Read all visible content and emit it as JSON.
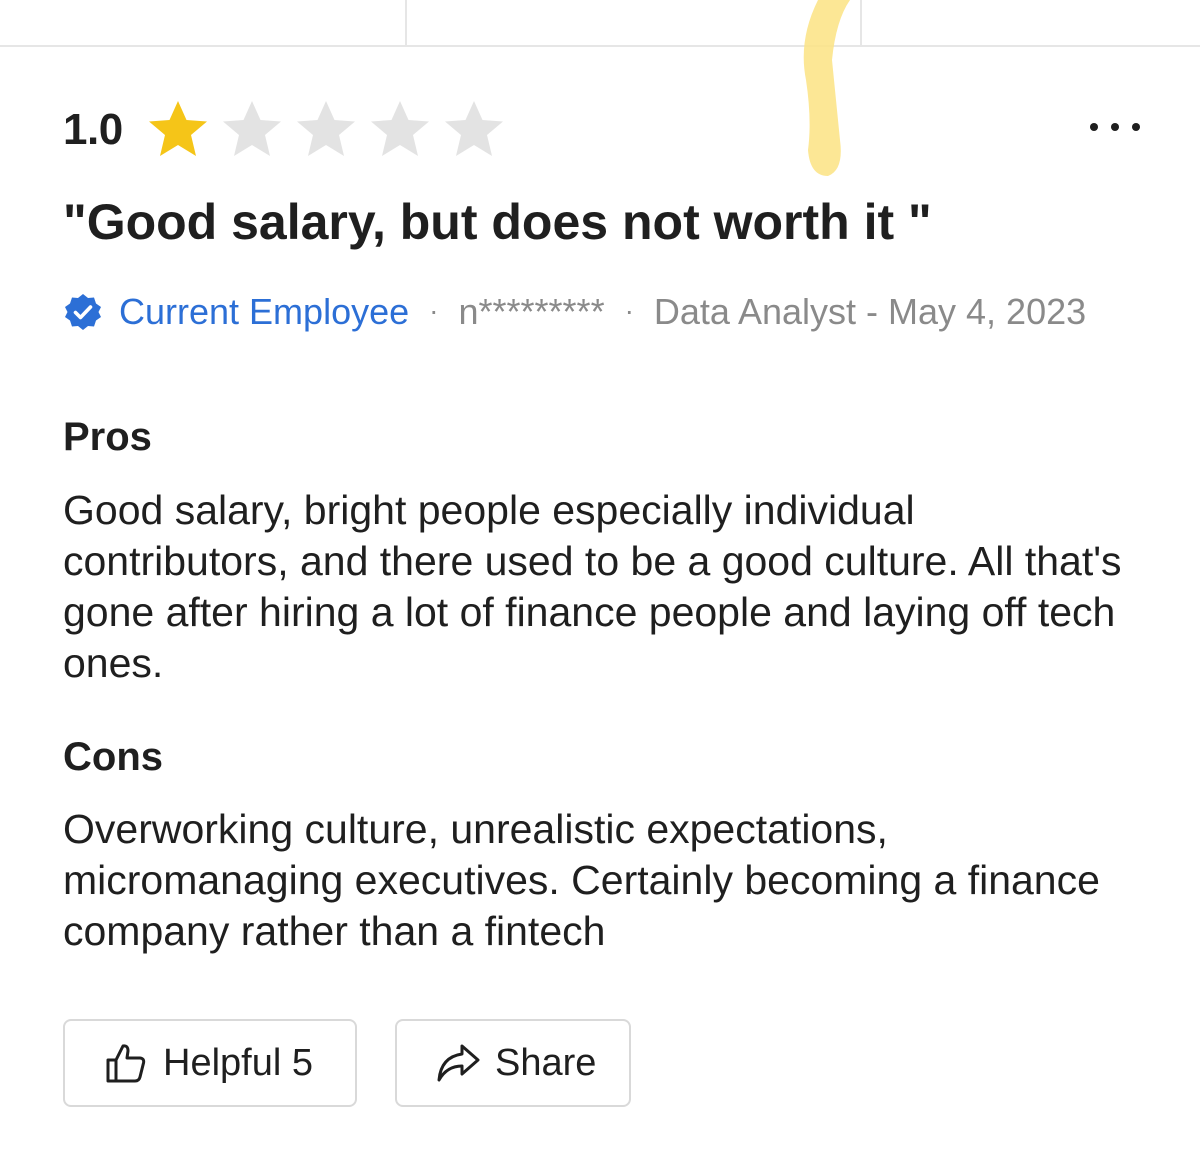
{
  "review": {
    "rating_value": "1.0",
    "rating": 1,
    "max_rating": 5,
    "title": "\"Good salary, but does not worth it \"",
    "employee_status": "Current Employee",
    "author": "n*********",
    "job_and_date": "Data Analyst - May 4, 2023",
    "separator": "·",
    "pros_heading": "Pros",
    "pros_text": "Good salary, bright people especially individual contributors, and there used to be a good culture. All that's gone after hiring a lot of finance people and laying off tech ones.",
    "cons_heading": "Cons",
    "cons_text": "Overworking culture, unrealistic expectations, micromanaging executives. Certainly becoming a finance company rather than a fintech"
  },
  "actions": {
    "helpful_label": "Helpful 5",
    "share_label": "Share"
  },
  "icons": {
    "star_filled": "star-filled-icon",
    "star_empty": "star-empty-icon",
    "verified": "verified-badge-icon",
    "more": "more-horizontal-icon",
    "thumbs_up": "thumbs-up-icon",
    "share": "share-arrow-icon"
  },
  "colors": {
    "star_filled": "#f5c518",
    "star_empty": "#e3e3e3",
    "verified_blue": "#2c6fd6",
    "text": "#1f1f1f",
    "muted": "#8a8a8a",
    "highlight": "#fbe382"
  }
}
